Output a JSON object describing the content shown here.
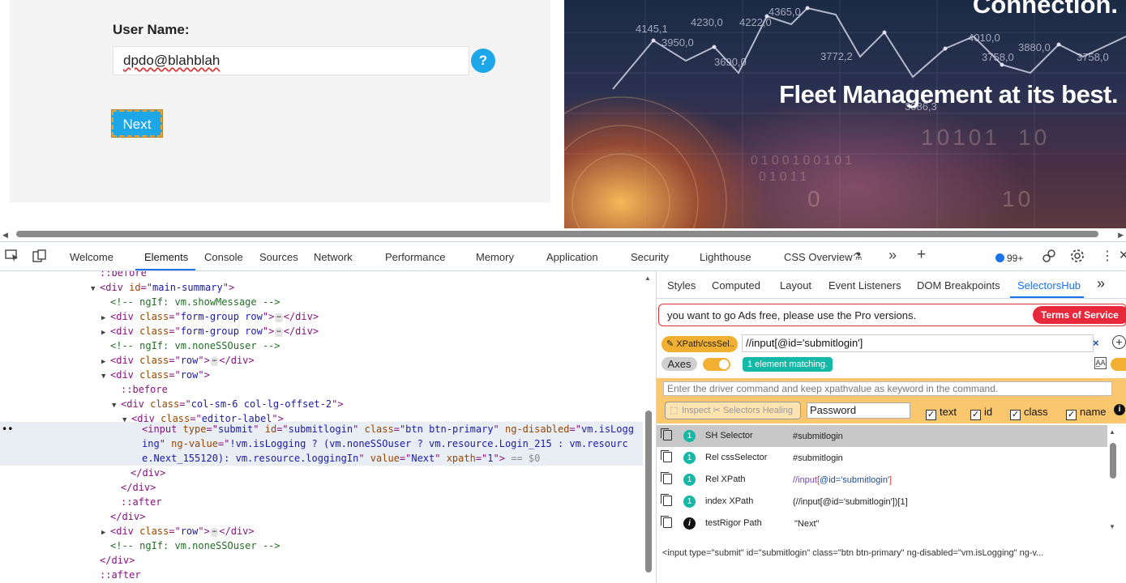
{
  "page": {
    "username_label": "User Name:",
    "username_value": "dpdo@blahblah",
    "help_glyph": "?",
    "next_label": "Next",
    "hero": {
      "title": "Connection.",
      "subtitle": "Fleet Management at its best.",
      "numbers": [
        "4145,1",
        "4230,0",
        "4222,0",
        "4365,0",
        "3950,0",
        "3690,0",
        "3772,2",
        "4010,0",
        "3758,0",
        "3880,0",
        "3758,0",
        "3086,3"
      ],
      "binary_text": [
        "10101",
        "10",
        "0100100101",
        "01011",
        "0",
        "10"
      ]
    }
  },
  "devtools": {
    "tabs": [
      "Welcome",
      "Elements",
      "Console",
      "Sources",
      "Network",
      "Performance",
      "Memory",
      "Application",
      "Security",
      "Lighthouse",
      "CSS Overview"
    ],
    "active_tab": "Elements",
    "badge_count": "99+",
    "icons": [
      "inspect-icon",
      "device-toggle-icon",
      "flask-icon",
      "more-tabs-icon",
      "plus-icon",
      "issues-icon",
      "link-icon",
      "gear-icon",
      "kebab-icon",
      "close-icon"
    ],
    "elements_lines": [
      {
        "indent": 0,
        "parts": [
          [
            "ps",
            "::before"
          ]
        ],
        "arrow": ""
      },
      {
        "indent": 1,
        "arrow": "down",
        "parts": [
          [
            "tg",
            "<div "
          ],
          [
            "at",
            "id"
          ],
          [
            "tg",
            "=\""
          ],
          [
            "av",
            "main-summary"
          ],
          [
            "tg",
            "\">"
          ]
        ]
      },
      {
        "indent": 2,
        "arrow": "",
        "parts": [
          [
            "cm",
            "<!-- ngIf: vm.showMessage -->"
          ]
        ]
      },
      {
        "indent": 2,
        "arrow": "right",
        "parts": [
          [
            "tg",
            "<div "
          ],
          [
            "at",
            "class"
          ],
          [
            "tg",
            "=\""
          ],
          [
            "av",
            "form-group row"
          ],
          [
            "tg",
            "\">"
          ],
          [
            "ell",
            "⋯"
          ],
          [
            "tg",
            "</div>"
          ]
        ]
      },
      {
        "indent": 2,
        "arrow": "right",
        "parts": [
          [
            "tg",
            "<div "
          ],
          [
            "at",
            "class"
          ],
          [
            "tg",
            "=\""
          ],
          [
            "av",
            "form-group row"
          ],
          [
            "tg",
            "\">"
          ],
          [
            "ell",
            "⋯"
          ],
          [
            "tg",
            "</div>"
          ]
        ]
      },
      {
        "indent": 2,
        "arrow": "",
        "parts": [
          [
            "cm",
            "<!-- ngIf: vm.noneSSOuser -->"
          ]
        ]
      },
      {
        "indent": 2,
        "arrow": "right",
        "parts": [
          [
            "tg",
            "<div "
          ],
          [
            "at",
            "class"
          ],
          [
            "tg",
            "=\""
          ],
          [
            "av",
            "row"
          ],
          [
            "tg",
            "\">"
          ],
          [
            "ell",
            "⋯"
          ],
          [
            "tg",
            "</div>"
          ]
        ]
      },
      {
        "indent": 2,
        "arrow": "down",
        "parts": [
          [
            "tg",
            "<div "
          ],
          [
            "at",
            "class"
          ],
          [
            "tg",
            "=\""
          ],
          [
            "av",
            "row"
          ],
          [
            "tg",
            "\">"
          ]
        ]
      },
      {
        "indent": 3,
        "arrow": "",
        "parts": [
          [
            "ps",
            "::before"
          ]
        ]
      },
      {
        "indent": 3,
        "arrow": "down",
        "parts": [
          [
            "tg",
            "<div "
          ],
          [
            "at",
            "class"
          ],
          [
            "tg",
            "=\""
          ],
          [
            "av",
            "col-sm-6 col-lg-offset-2"
          ],
          [
            "tg",
            "\">"
          ]
        ]
      },
      {
        "indent": 4,
        "arrow": "down",
        "parts": [
          [
            "tg",
            "<div "
          ],
          [
            "at",
            "class"
          ],
          [
            "tg",
            "=\""
          ],
          [
            "av",
            "editor-label"
          ],
          [
            "tg",
            "\">"
          ]
        ]
      }
    ],
    "selected_lines": [
      [
        [
          "tg",
          "<input "
        ],
        [
          "at",
          "type"
        ],
        [
          "tg",
          "=\""
        ],
        [
          "av",
          "submit"
        ],
        [
          "tg",
          "\" "
        ],
        [
          "at",
          "id"
        ],
        [
          "tg",
          "=\""
        ],
        [
          "av",
          "submitlogin"
        ],
        [
          "tg",
          "\" "
        ],
        [
          "at",
          "class"
        ],
        [
          "tg",
          "=\""
        ],
        [
          "av",
          "btn btn-primary"
        ],
        [
          "tg",
          "\" "
        ],
        [
          "at",
          "ng-disabled"
        ],
        [
          "tg",
          "=\""
        ],
        [
          "av",
          "vm.isLogg"
        ]
      ],
      [
        [
          "av",
          "ing"
        ],
        [
          "tg",
          "\" "
        ],
        [
          "at",
          "ng-value"
        ],
        [
          "tg",
          "=\""
        ],
        [
          "av",
          "!vm.isLogging ? (vm.noneSSOuser ? vm.resource.Login_215 : vm.resourc"
        ]
      ],
      [
        [
          "av",
          "e.Next_155120): vm.resource.loggingIn"
        ],
        [
          "tg",
          "\" "
        ],
        [
          "at",
          "value"
        ],
        [
          "tg",
          "=\""
        ],
        [
          "av",
          "Next"
        ],
        [
          "tg",
          "\" "
        ],
        [
          "at",
          "xpath"
        ],
        [
          "tg",
          "=\""
        ],
        [
          "av",
          "1"
        ],
        [
          "tg",
          "\">"
        ],
        [
          "dim",
          " == $0"
        ]
      ]
    ],
    "after_lines": [
      {
        "indent": 5,
        "arrow": "",
        "parts": [
          [
            "tg",
            "</div>"
          ]
        ]
      },
      {
        "indent": 4,
        "arrow": "",
        "parts": [
          [
            "tg",
            "</div>"
          ]
        ]
      },
      {
        "indent": 4,
        "arrow": "",
        "parts": [
          [
            "ps",
            "::after"
          ]
        ]
      },
      {
        "indent": 3,
        "arrow": "",
        "parts": [
          [
            "tg",
            "</div>"
          ]
        ]
      },
      {
        "indent": 2,
        "arrow": "right",
        "parts": [
          [
            "tg",
            "<div "
          ],
          [
            "at",
            "class"
          ],
          [
            "tg",
            "=\""
          ],
          [
            "av",
            "row"
          ],
          [
            "tg",
            "\">"
          ],
          [
            "ell",
            "⋯"
          ],
          [
            "tg",
            "</div>"
          ]
        ]
      },
      {
        "indent": 2,
        "arrow": "",
        "parts": [
          [
            "cm",
            "<!-- ngIf: vm.noneSSOuser -->"
          ]
        ]
      },
      {
        "indent": 1,
        "arrow": "",
        "parts": [
          [
            "tg",
            "</div>"
          ]
        ]
      },
      {
        "indent": 1,
        "arrow": "",
        "parts": [
          [
            "ps",
            "::after"
          ]
        ]
      }
    ],
    "side_tabs": [
      "Styles",
      "Computed",
      "Layout",
      "Event Listeners",
      "DOM Breakpoints",
      "SelectorsHub"
    ],
    "active_side_tab": "SelectorsHub"
  },
  "selectorshub": {
    "ads_text": "you want to go Ads free, please use the Pro versions.",
    "tos_label": "Terms of Service",
    "xpath_type_label": "XPath/cssSel..",
    "xpath_value": "//input[@id='submitlogin']",
    "clear_glyph": "×",
    "add_glyph": "+",
    "axes_label": "Axes",
    "match_text": "1 element matching.",
    "aa_glyph": "A̲A",
    "cmd_placeholder": "Enter the driver command and keep xpathvalue as keyword in the command.",
    "inspect_label": "Inspect",
    "healing_label": "Selectors Healing",
    "attr_value": "Password",
    "checks": [
      {
        "label": "text",
        "checked": true
      },
      {
        "label": "id",
        "checked": true
      },
      {
        "label": "class",
        "checked": true
      },
      {
        "label": "name",
        "checked": true
      }
    ],
    "info_glyph": "i",
    "results": [
      {
        "count": "1",
        "name": "SH Selector",
        "value": "#submitlogin",
        "highlight": true
      },
      {
        "count": "1",
        "name": "Rel cssSelector",
        "value": "#submitlogin",
        "highlight": false
      },
      {
        "count": "1",
        "name": "Rel XPath",
        "value": "//input[@id='submitlogin']",
        "highlight": false,
        "xpath": true
      },
      {
        "count": "1",
        "name": "index XPath",
        "value": "(//input[@id='submitlogin'])[1]",
        "highlight": false
      },
      {
        "count": "i",
        "name": "testRigor Path",
        "value": "\"Next\"",
        "highlight": false,
        "info": true
      }
    ],
    "outer_html": "<input type=\"submit\" id=\"submitlogin\" class=\"btn btn-primary\" ng-disabled=\"vm.isLogging\" ng-v..."
  },
  "colors": {
    "accent": "#1ea7e8",
    "devtools_blue": "#1a73e8",
    "sh_orange": "#f2b033",
    "teal": "#14b8a6",
    "tos_red": "#e8283b"
  }
}
